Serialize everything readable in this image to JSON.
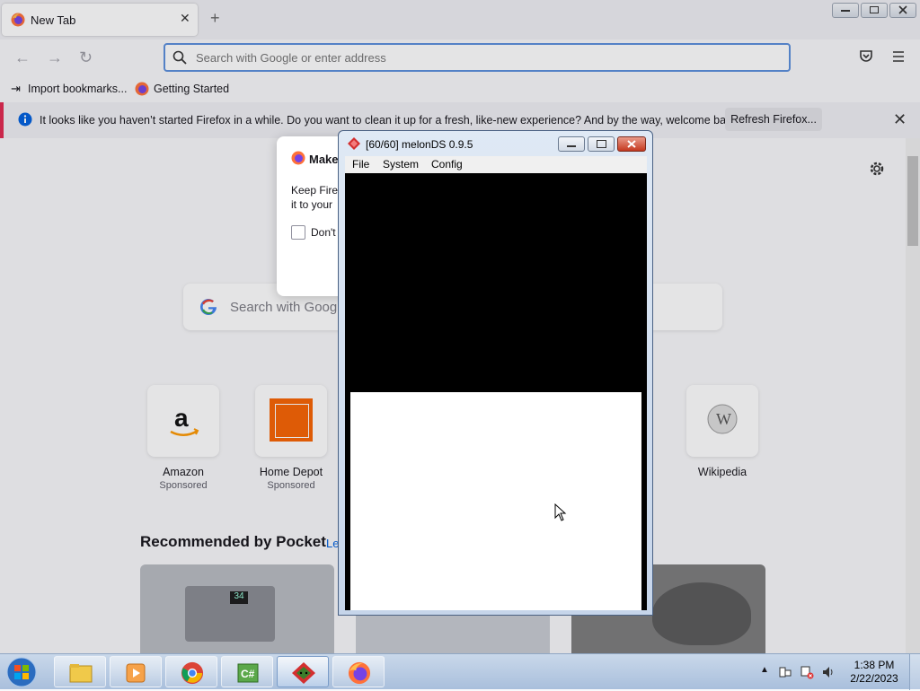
{
  "firefox": {
    "tab": {
      "title": "New Tab",
      "close": "✕"
    },
    "new_tab_label": "+",
    "urlbar": {
      "placeholder": "Search with Google or enter address"
    },
    "bookmarks": [
      {
        "label": "Import bookmarks..."
      },
      {
        "label": "Getting Started"
      }
    ],
    "notification": {
      "text": "It looks like you haven’t started Firefox in a while. Do you want to clean it up for a fresh, like-new experience? And by the way, welcome back!",
      "button": "Refresh Firefox...",
      "close": "✕"
    },
    "modal": {
      "title": "Make",
      "body_line1": "Keep Firef",
      "body_line2": "it to your",
      "checkbox_label": "Don't"
    },
    "search": {
      "placeholder": "Search with Goog"
    },
    "top_sites": [
      {
        "name": "Amazon",
        "sponsored": "Sponsored"
      },
      {
        "name": "Home Depot",
        "sponsored": "Sponsored"
      },
      {
        "name": "Wikipedia",
        "sponsored": ""
      }
    ],
    "pocket": {
      "heading": "Recommended by Pocket",
      "learn_more": "Le"
    }
  },
  "melonds": {
    "title": "[60/60] melonDS 0.9.5",
    "menus": [
      "File",
      "System",
      "Config"
    ]
  },
  "taskbar": {
    "apps": [
      "windows-explorer",
      "media-player",
      "chrome",
      "csharp-editor",
      "melonds",
      "firefox"
    ],
    "clock": {
      "time": "1:38 PM",
      "date": "2/22/2023"
    }
  },
  "colors": {
    "notification_accent": "#e22850",
    "urlbar_focus": "#5b8fdc",
    "melon_red": "#d32f2f"
  }
}
